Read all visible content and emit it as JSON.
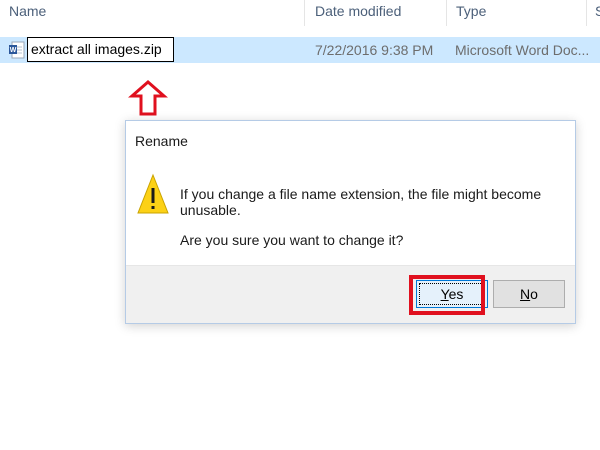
{
  "columns": {
    "name": "Name",
    "date_modified": "Date modified",
    "type": "Type",
    "size_partial": "S"
  },
  "file": {
    "icon": "word-doc-icon",
    "rename_value": "extract all images.zip",
    "date_modified": "7/22/2016 9:38 PM",
    "type": "Microsoft Word Doc..."
  },
  "dialog": {
    "title": "Rename",
    "icon": "warning-icon",
    "message": "If you change a file name extension, the file might become unusable.",
    "question": "Are you sure you want to change it?",
    "yes_label_first": "Y",
    "yes_label_rest": "es",
    "no_label_first": "N",
    "no_label_rest": "o"
  },
  "colors": {
    "selection": "#cce8ff",
    "highlight": "#e0101e",
    "accent": "#0078d7"
  }
}
